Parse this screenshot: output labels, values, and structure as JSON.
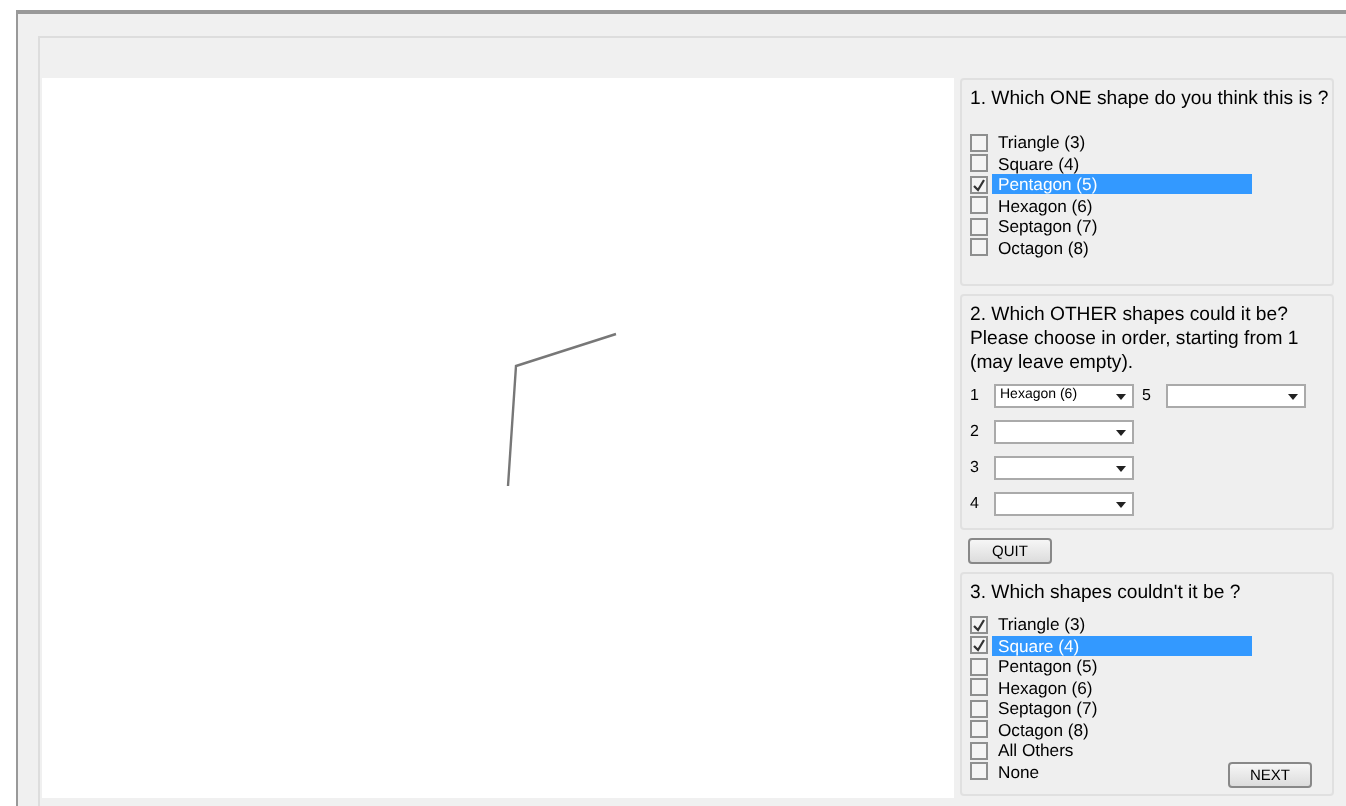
{
  "question_1": {
    "title": "1. Which ONE shape do you think this is ?",
    "options": [
      {
        "label": "Triangle (3)",
        "checked": false,
        "selected": false
      },
      {
        "label": "Square (4)",
        "checked": false,
        "selected": false
      },
      {
        "label": "Pentagon (5)",
        "checked": true,
        "selected": true
      },
      {
        "label": "Hexagon (6)",
        "checked": false,
        "selected": false
      },
      {
        "label": "Septagon (7)",
        "checked": false,
        "selected": false
      },
      {
        "label": "Octagon (8)",
        "checked": false,
        "selected": false
      }
    ]
  },
  "question_2": {
    "title_lines": [
      "2. Which OTHER shapes could it be?",
      "Please choose in order, starting from 1",
      "(may leave empty)."
    ],
    "choices": [
      {
        "number": "1",
        "value": "Hexagon (6)"
      },
      {
        "number": "2"
      },
      {
        "number": "3"
      },
      {
        "number": "4"
      },
      {
        "number": "5"
      }
    ]
  },
  "quit_button": "QUIT",
  "question_3": {
    "title": "3. Which shapes couldn't it be  ?",
    "options": [
      {
        "label": "Triangle (3)",
        "checked": true,
        "selected": false
      },
      {
        "label": "Square (4)",
        "checked": true,
        "selected": true
      },
      {
        "label": "Pentagon (5)",
        "checked": false,
        "selected": false
      },
      {
        "label": "Hexagon (6)",
        "checked": false,
        "selected": false
      },
      {
        "label": "Septagon (7)",
        "checked": false,
        "selected": false
      },
      {
        "label": "Octagon (8)",
        "checked": false,
        "selected": false
      },
      {
        "label": "All Others",
        "checked": false,
        "selected": false
      },
      {
        "label": "None",
        "checked": false,
        "selected": false
      }
    ]
  },
  "next_button": "NEXT"
}
